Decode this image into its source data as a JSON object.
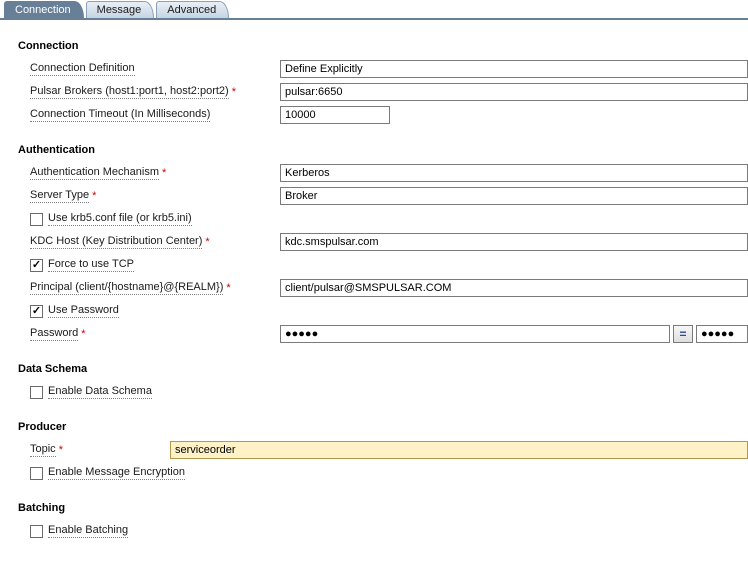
{
  "tabs": {
    "connection": "Connection",
    "message": "Message",
    "advanced": "Advanced"
  },
  "sections": {
    "connection": {
      "header": "Connection",
      "definition_label": "Connection Definition",
      "definition_value": "Define Explicitly",
      "brokers_label": "Pulsar Brokers (host1:port1, host2:port2)",
      "brokers_value": "pulsar:6650",
      "timeout_label": "Connection Timeout (In Milliseconds)",
      "timeout_value": "10000"
    },
    "auth": {
      "header": "Authentication",
      "mechanism_label": "Authentication Mechanism",
      "mechanism_value": "Kerberos",
      "server_type_label": "Server Type",
      "server_type_value": "Broker",
      "use_krb5_label": "Use krb5.conf file (or krb5.ini)",
      "kdc_label": "KDC Host (Key Distribution Center)",
      "kdc_value": "kdc.smspulsar.com",
      "force_tcp_label": "Force to use TCP",
      "principal_label": "Principal (client/{hostname}@{REALM})",
      "principal_value": "client/pulsar@SMSPULSAR.COM",
      "use_password_label": "Use Password",
      "password_label": "Password",
      "password_value": "●●●●●",
      "password_confirm_value": "●●●●●",
      "eq_symbol": "="
    },
    "schema": {
      "header": "Data Schema",
      "enable_label": "Enable Data Schema"
    },
    "producer": {
      "header": "Producer",
      "topic_label": "Topic",
      "topic_value": "serviceorder",
      "enable_encryption_label": "Enable Message Encryption"
    },
    "batching": {
      "header": "Batching",
      "enable_label": "Enable Batching"
    }
  },
  "req": "*"
}
